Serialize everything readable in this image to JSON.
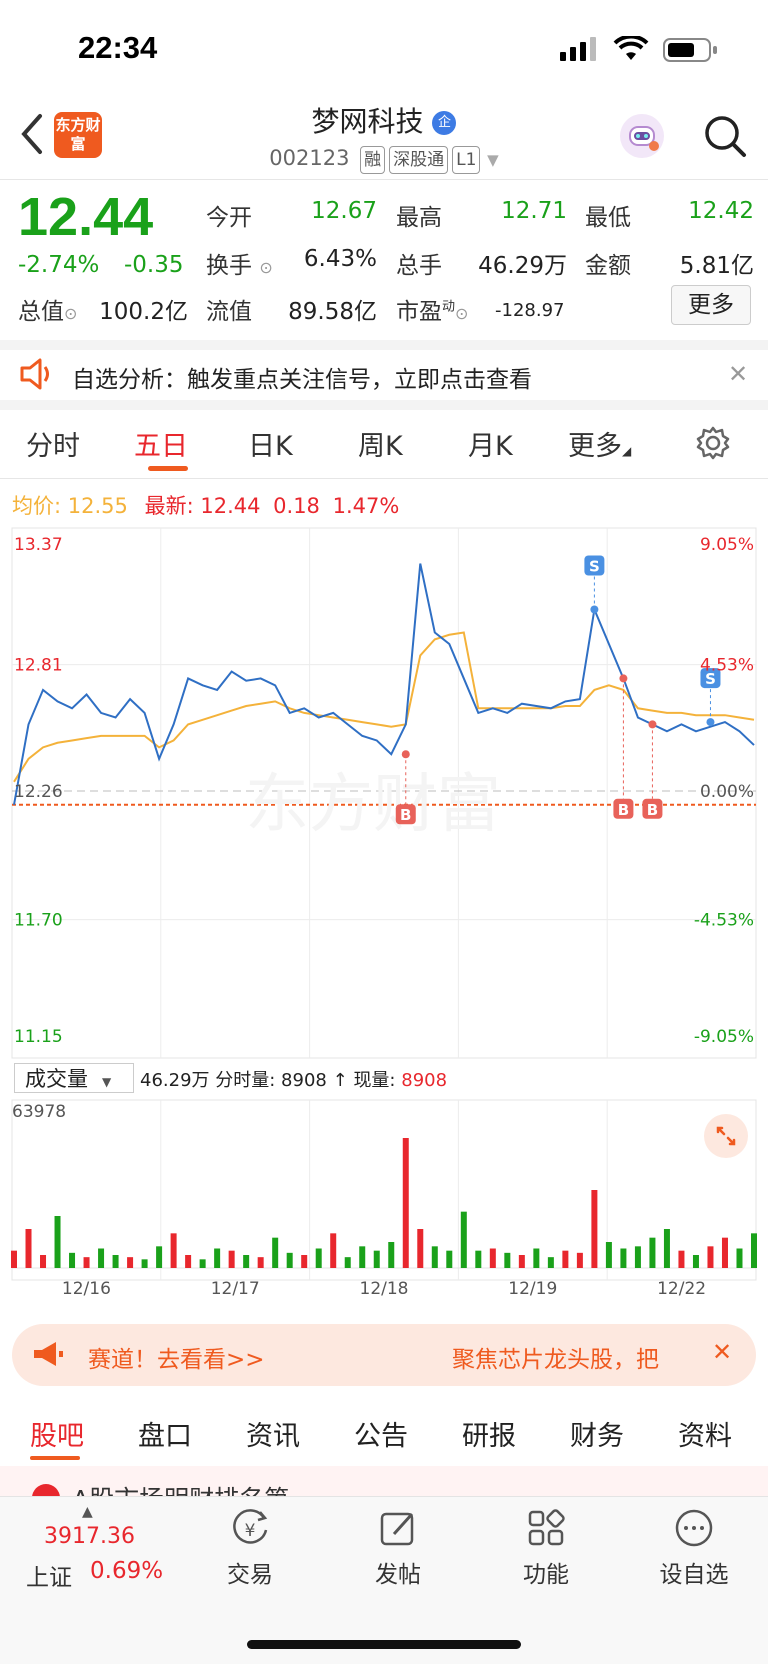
{
  "status": {
    "time": "22:34"
  },
  "header": {
    "title": "梦网科技",
    "code": "002123",
    "tags": [
      "融",
      "深股通",
      "L1"
    ],
    "logo_text": "东方财富"
  },
  "quote": {
    "price": "12.44",
    "change_pct": "-2.74%",
    "change_amt": "-0.35",
    "open_label": "今开",
    "open": "12.67",
    "high_label": "最高",
    "high": "12.71",
    "low_label": "最低",
    "low": "12.42",
    "turnover_label": "换手",
    "turnover": "6.43%",
    "volume_label": "总手",
    "volume": "46.29万",
    "amount_label": "金额",
    "amount": "5.81亿",
    "mktcap_label": "总值",
    "mktcap": "100.2亿",
    "float_label": "流值",
    "float": "89.58亿",
    "pe_label": "市盈",
    "pe_sup": "动",
    "pe": "-128.97",
    "more_label": "更多"
  },
  "notice": {
    "text": "自选分析：触发重点关注信号，立即点击查看"
  },
  "tabs": [
    "分时",
    "五日",
    "日K",
    "周K",
    "月K",
    "更多"
  ],
  "active_tab": "五日",
  "legend": {
    "avg_label": "均价:",
    "avg": "12.55",
    "latest_label": "最新:",
    "latest": "12.44",
    "chg": "0.18",
    "chg_pct": "1.47%"
  },
  "chart_data": {
    "type": "line",
    "y_left_ticks": [
      "13.37",
      "12.81",
      "12.26",
      "11.70",
      "11.15"
    ],
    "y_right_ticks": [
      "9.05%",
      "4.53%",
      "0.00%",
      "-4.53%",
      "-9.05%"
    ],
    "x_labels": [
      "12/16",
      "12/17",
      "12/18",
      "12/19",
      "12/22"
    ],
    "ylim": [
      11.15,
      13.37
    ],
    "prev_close": 12.26,
    "cost_line": 12.2,
    "price": [
      12.2,
      12.55,
      12.7,
      12.65,
      12.62,
      12.68,
      12.6,
      12.58,
      12.66,
      12.6,
      12.4,
      12.55,
      12.75,
      12.72,
      12.7,
      12.78,
      12.74,
      12.75,
      12.72,
      12.6,
      12.62,
      12.58,
      12.6,
      12.55,
      12.5,
      12.48,
      12.42,
      12.55,
      13.25,
      12.95,
      12.9,
      12.75,
      12.6,
      12.62,
      12.6,
      12.64,
      12.63,
      12.62,
      12.65,
      12.66,
      13.05,
      12.9,
      12.75,
      12.58,
      12.55,
      12.52,
      12.55,
      12.52,
      12.54,
      12.56,
      12.52,
      12.46
    ],
    "avg": [
      12.3,
      12.4,
      12.45,
      12.47,
      12.48,
      12.49,
      12.5,
      12.5,
      12.5,
      12.5,
      12.45,
      12.48,
      12.55,
      12.57,
      12.59,
      12.61,
      12.63,
      12.64,
      12.65,
      12.62,
      12.6,
      12.59,
      12.58,
      12.57,
      12.56,
      12.55,
      12.54,
      12.55,
      12.85,
      12.92,
      12.94,
      12.95,
      12.62,
      12.62,
      12.62,
      12.62,
      12.62,
      12.62,
      12.63,
      12.63,
      12.7,
      12.72,
      12.7,
      12.62,
      12.61,
      12.6,
      12.6,
      12.59,
      12.59,
      12.59,
      12.58,
      12.57
    ],
    "trades": [
      {
        "type": "B",
        "x_index": 27,
        "price": 12.42
      },
      {
        "type": "S",
        "x_index": 40,
        "price": 13.05
      },
      {
        "type": "B",
        "x_index": 42,
        "price": 12.75
      },
      {
        "type": "B",
        "x_index": 44,
        "price": 12.55
      },
      {
        "type": "S",
        "x_index": 48,
        "price": 12.56
      }
    ],
    "volume": {
      "label": "成交量",
      "total": "46.29万",
      "tick_label": "分时量: 8908",
      "current_label": "现量:",
      "current": "8908",
      "max_tick": "63978",
      "values": [
        8,
        18,
        6,
        24,
        7,
        5,
        9,
        6,
        5,
        4,
        10,
        16,
        6,
        4,
        9,
        8,
        6,
        5,
        14,
        7,
        6,
        9,
        16,
        5,
        10,
        8,
        12,
        60,
        18,
        10,
        8,
        26,
        8,
        9,
        7,
        6,
        9,
        5,
        8,
        7,
        36,
        12,
        9,
        10,
        14,
        18,
        8,
        6,
        10,
        14,
        9,
        16
      ]
    }
  },
  "promo": {
    "left_text": "赛道！去看看>>",
    "right_text": "聚焦芯片龙头股，把"
  },
  "sub_tabs": [
    "股吧",
    "盘口",
    "资讯",
    "公告",
    "研报",
    "财务",
    "资料"
  ],
  "active_sub_tab": "股吧",
  "peek_text": "A股市场明财排名第",
  "index": {
    "value": "3917.36",
    "name": "上证",
    "pct": "0.69%"
  },
  "bottom_nav": [
    "交易",
    "发帖",
    "功能",
    "设自选"
  ],
  "colors": {
    "up": "#e8272d",
    "down": "#1aa11a",
    "price_line": "#2f6fc4",
    "avg_line": "#f4b23a",
    "accent": "#ef5a1f"
  }
}
